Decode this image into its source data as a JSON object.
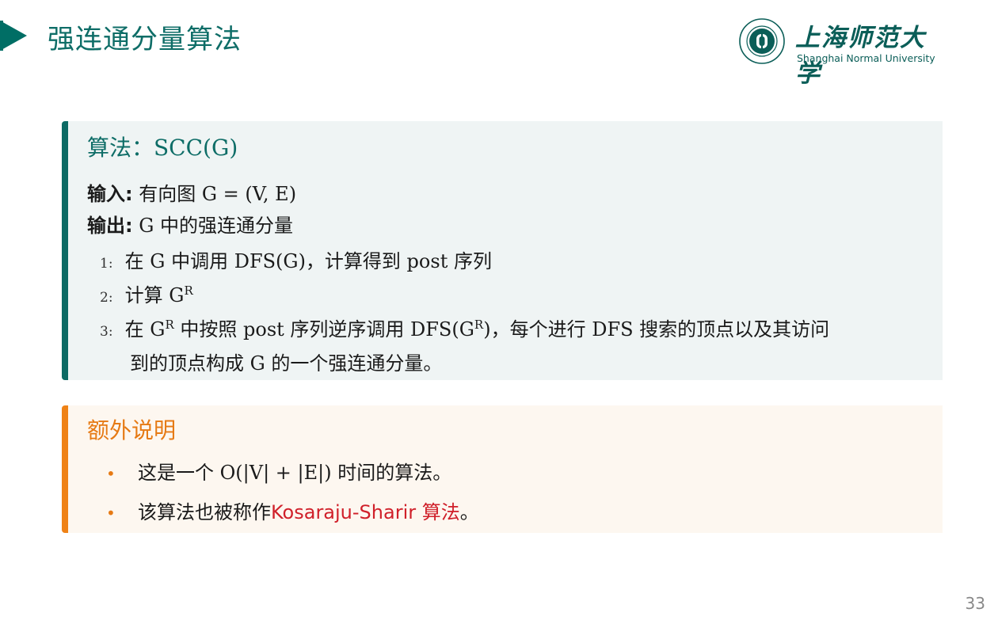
{
  "header": {
    "title": "强连通分量算法"
  },
  "logo": {
    "cn_name": "上海师范大学",
    "en_name": "Shanghai Normal University"
  },
  "algorithm": {
    "title": "算法：SCC(G)",
    "input_label": "输入:",
    "input_text": "有向图 G = (V, E)",
    "output_label": "输出:",
    "output_text": "G 中的强连通分量",
    "steps": [
      {
        "num": "1:",
        "text_pre": "在 G 中调用 DFS(G)，计算得到 post 序列"
      },
      {
        "num": "2:",
        "text_pre": "计算 G",
        "sup": "R"
      },
      {
        "num": "3:",
        "part1": "在 G",
        "sup1": "R",
        "part2": " 中按照 post 序列逆序调用 DFS(G",
        "sup2": "R",
        "part3": ")，每个进行 DFS 搜索的顶点以及其访问",
        "continuation": "到的顶点构成 G 的一个强连通分量。"
      }
    ]
  },
  "note": {
    "title": "额外说明",
    "bullet_char": "•",
    "items": [
      {
        "text": "这是一个 O(|V| + |E|) 时间的算法。"
      },
      {
        "text_pre": "该算法也被称作",
        "highlight": "Kosaraju-Sharir 算法",
        "text_post": "。"
      }
    ]
  },
  "page_number": "33",
  "colors": {
    "teal": "#0e6d67",
    "orange": "#e67a14",
    "red": "#d0202a"
  }
}
